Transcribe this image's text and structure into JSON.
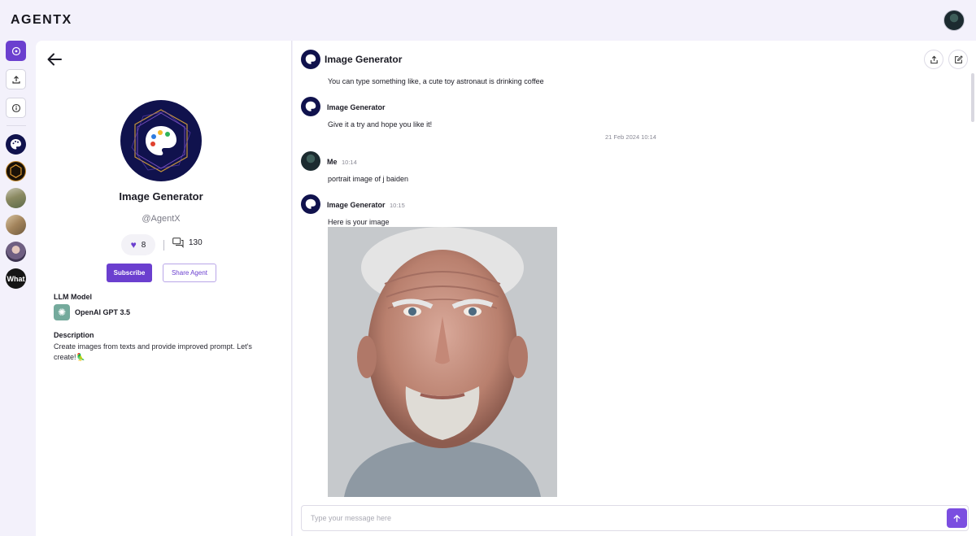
{
  "app": {
    "logo": "AGENTX"
  },
  "rail": {
    "agents": [
      {
        "name": "image-generator"
      },
      {
        "name": "hexagon-agent"
      },
      {
        "name": "landscape-agent"
      },
      {
        "name": "painting-agent"
      },
      {
        "name": "portrait-agent"
      },
      {
        "name": "what-agent",
        "label": "What"
      }
    ]
  },
  "profile": {
    "name": "Image Generator",
    "handle": "@AgentX",
    "likes": "8",
    "comments": "130",
    "subscribe_label": "Subscribe",
    "share_label": "Share Agent",
    "llm_title": "LLM Model",
    "llm_value": "OpenAI GPT 3.5",
    "description_title": "Description",
    "description_text": "Create images from texts and provide improved prompt. Let's create!🦜"
  },
  "chat": {
    "title": "Image Generator",
    "messages": [
      {
        "text": "You can type something like, a cute toy astronaut is drinking coffee"
      },
      {
        "sender": "Image Generator",
        "time": "",
        "text": "Give it a try and hope you like it!"
      },
      {
        "date": "21 Feb 2024 10:14"
      },
      {
        "sender": "Me",
        "time": "10:14",
        "text": "portrait image of j baiden"
      },
      {
        "sender": "Image Generator",
        "time": "10:15",
        "text": "Here is your image"
      }
    ],
    "composer_placeholder": "Type your message here"
  },
  "colors": {
    "accent": "#6b3fcf",
    "agent_bg": "#10124d"
  },
  "icons": {
    "back": "arrow-left-icon",
    "share": "share-icon",
    "edit": "edit-icon",
    "send": "arrow-up-icon",
    "heart": "heart-icon",
    "comments": "comments-icon"
  }
}
